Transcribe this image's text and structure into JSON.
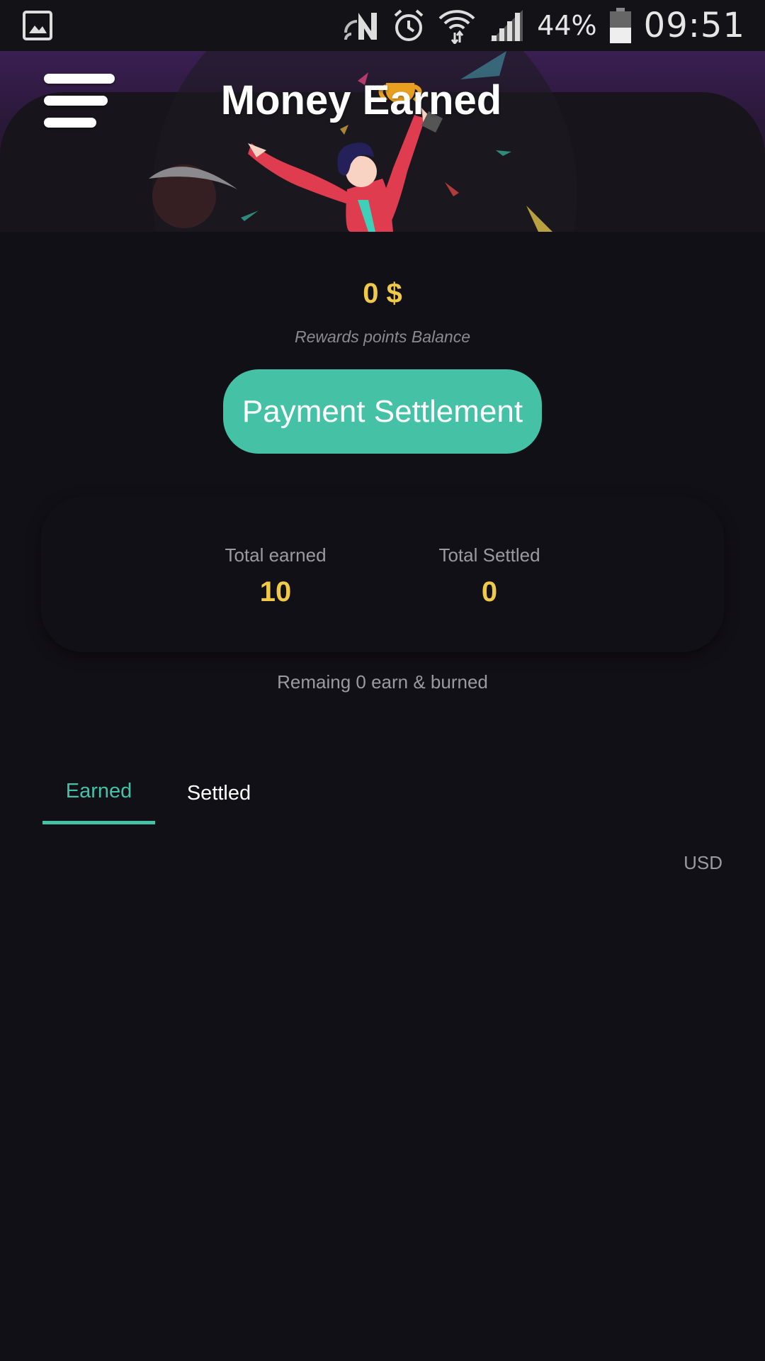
{
  "status_bar": {
    "battery_percent": "44%",
    "time": "09:51",
    "icons": [
      "gallery-icon",
      "nfc-icon",
      "alarm-icon",
      "wifi-icon",
      "signal-icon",
      "battery-icon"
    ]
  },
  "header": {
    "title": "Money Earned"
  },
  "balance": {
    "value": "0 $",
    "label": "Rewards points Balance"
  },
  "actions": {
    "settle_label": "Payment Settlement"
  },
  "stats": {
    "earned_label": "Total earned",
    "earned_value": "10",
    "settled_label": "Total Settled",
    "settled_value": "0"
  },
  "remaining_text": "Remaing 0 earn & burned",
  "tabs": [
    {
      "label": "Earned",
      "active": true
    },
    {
      "label": "Settled",
      "active": false
    }
  ],
  "currency": "USD",
  "colors": {
    "accent": "#45c2a5",
    "highlight": "#f0c94a",
    "background": "#121017"
  }
}
